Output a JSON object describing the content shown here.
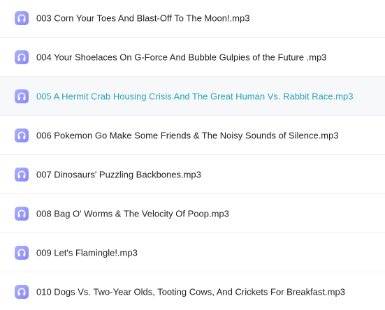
{
  "files": {
    "items": [
      {
        "name": "003 Corn Your Toes And Blast-Off To The Moon!.mp3",
        "icon": "headphones-icon"
      },
      {
        "name": "004 Your Shoelaces On G-Force And Bubble Gulpies of the Future .mp3",
        "icon": "headphones-icon"
      },
      {
        "name": "005 A Hermit Crab Housing Crisis And The Great Human Vs. Rabbit Race.mp3",
        "icon": "headphones-icon",
        "active": true
      },
      {
        "name": "006 Pokemon Go Make Some Friends & The Noisy Sounds of Silence.mp3",
        "icon": "headphones-icon"
      },
      {
        "name": "007 Dinosaurs' Puzzling Backbones.mp3",
        "icon": "headphones-icon"
      },
      {
        "name": "008 Bag O' Worms & The Velocity Of Poop.mp3",
        "icon": "headphones-icon"
      },
      {
        "name": "009 Let's Flamingle!.mp3",
        "icon": "headphones-icon"
      },
      {
        "name": "010 Dogs Vs. Two-Year Olds, Tooting Cows, And Crickets For Breakfast.mp3",
        "icon": "headphones-icon"
      }
    ]
  },
  "colors": {
    "active_text": "#2aa3b3",
    "icon_gradient_start": "#aab0ff",
    "icon_gradient_end": "#8a86f5"
  }
}
